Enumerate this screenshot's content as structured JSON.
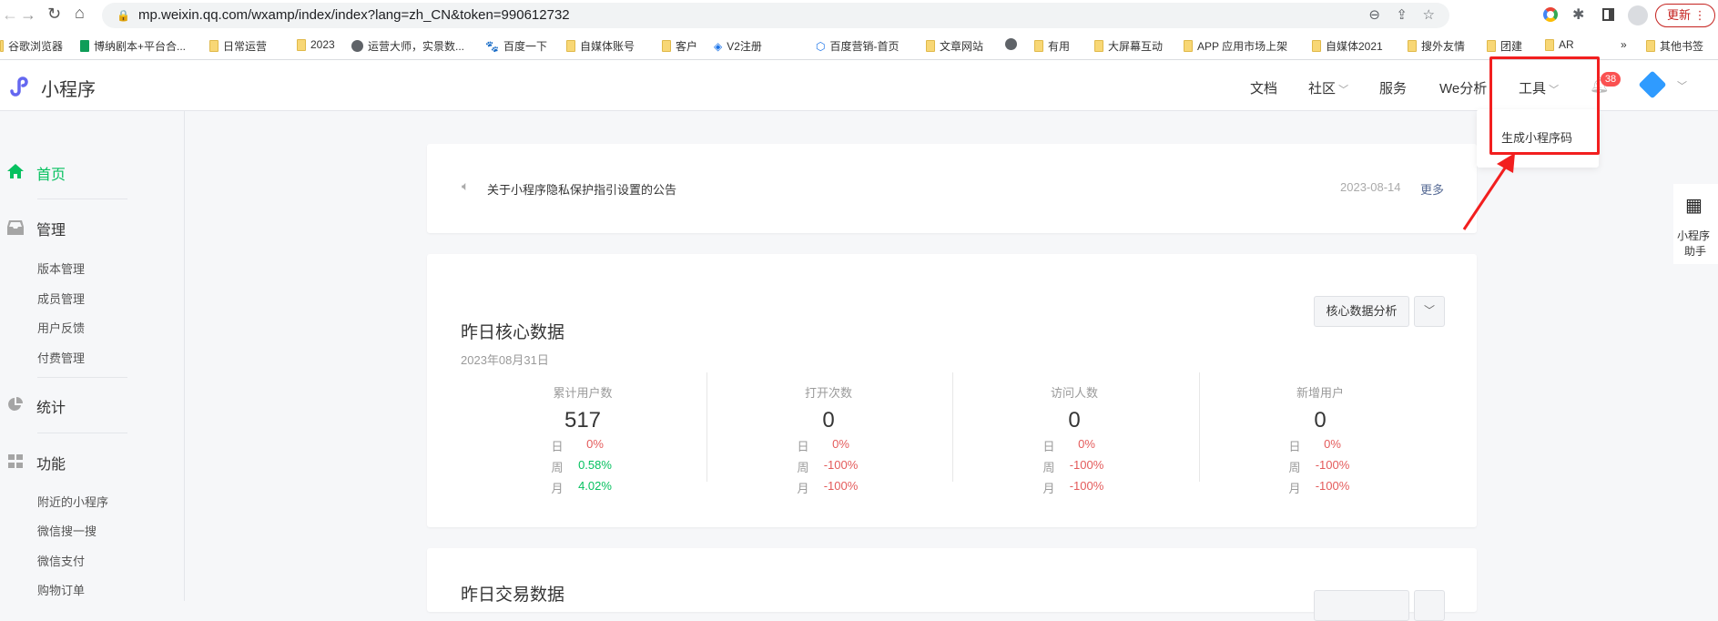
{
  "browser": {
    "url": "mp.weixin.qq.com/wxamp/index/index?lang=zh_CN&token=990612732",
    "update_label": "更新",
    "bookmarks": [
      "谷歌浏览器",
      "博纳剧本+平台合...",
      "日常运营",
      "2023",
      "运营大师，实景数...",
      "百度一下",
      "自媒体账号",
      "客户",
      "V2注册",
      "百度营销-首页",
      "文章网站",
      "有用",
      "大屏幕互动",
      "APP 应用市场上架",
      "自媒体2021",
      "搜外友情",
      "团建",
      "AR"
    ],
    "more_bookmarks": "»",
    "other_bookmarks": "其他书签"
  },
  "header": {
    "logo_text": "小程序",
    "nav": [
      "文档",
      "社区",
      "服务",
      "We分析",
      "工具"
    ],
    "notification_count": "38"
  },
  "dropdown": {
    "items": [
      "生成小程序码"
    ]
  },
  "sidebar": {
    "home": "首页",
    "manage": "管理",
    "manage_items": [
      "版本管理",
      "成员管理",
      "用户反馈",
      "付费管理"
    ],
    "stats": "统计",
    "features": "功能",
    "feature_items": [
      "附近的小程序",
      "微信搜一搜",
      "微信支付",
      "购物订单"
    ]
  },
  "notice": {
    "text": "关于小程序隐私保护指引设置的公告",
    "date": "2023-08-14",
    "more": "更多"
  },
  "core": {
    "title": "昨日核心数据",
    "date": "2023年08月31日",
    "analysis_button": "核心数据分析",
    "metrics": [
      {
        "label": "累计用户数",
        "value": "517",
        "day_k": "日",
        "day": "0%",
        "week_k": "周",
        "week": "0.58%",
        "month_k": "月",
        "month": "4.02%"
      },
      {
        "label": "打开次数",
        "value": "0",
        "day_k": "日",
        "day": "0%",
        "week_k": "周",
        "week": "-100%",
        "month_k": "月",
        "month": "-100%"
      },
      {
        "label": "访问人数",
        "value": "0",
        "day_k": "日",
        "day": "0%",
        "week_k": "周",
        "week": "-100%",
        "month_k": "月",
        "month": "-100%"
      },
      {
        "label": "新增用户",
        "value": "0",
        "day_k": "日",
        "day": "0%",
        "week_k": "周",
        "week": "-100%",
        "month_k": "月",
        "month": "-100%"
      }
    ]
  },
  "trade": {
    "title": "昨日交易数据"
  },
  "assistant": {
    "label1": "小程序",
    "label2": "助手"
  }
}
